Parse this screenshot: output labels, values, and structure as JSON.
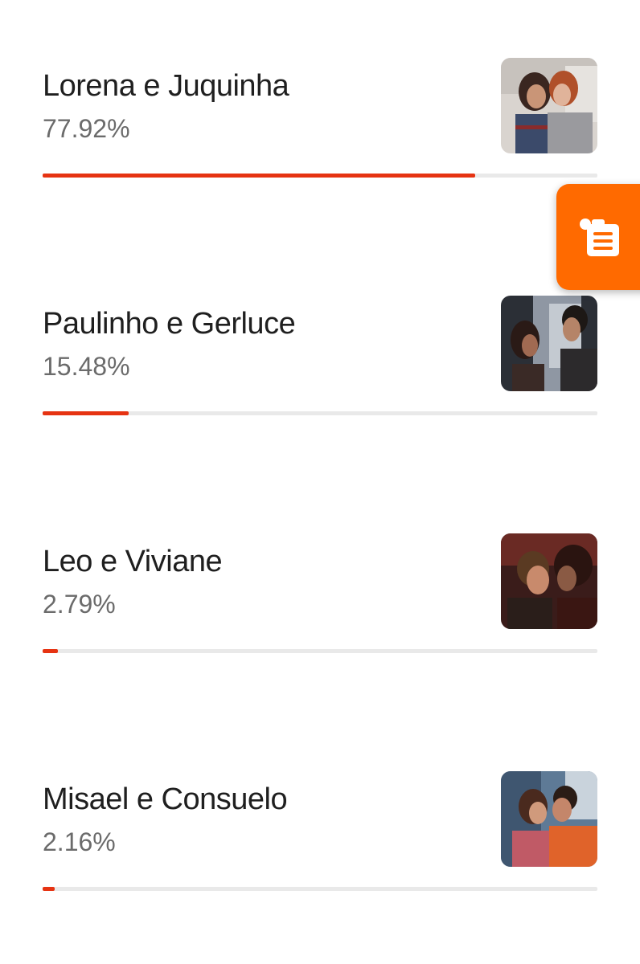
{
  "colors": {
    "accent": "#e63312",
    "fab": "#ff6a00",
    "track": "#e9e9e9"
  },
  "poll": {
    "options": [
      {
        "name": "Lorena e Juquinha",
        "percent": "77.92%",
        "value": 77.92,
        "thumb_icon": "couple-photo-1"
      },
      {
        "name": "Paulinho e Gerluce",
        "percent": "15.48%",
        "value": 15.48,
        "thumb_icon": "couple-photo-2"
      },
      {
        "name": "Leo e Viviane",
        "percent": "2.79%",
        "value": 2.79,
        "thumb_icon": "couple-photo-3"
      },
      {
        "name": "Misael e Consuelo",
        "percent": "2.16%",
        "value": 2.16,
        "thumb_icon": "couple-photo-4"
      }
    ]
  },
  "floating_button": {
    "icon": "clipboard-list-icon"
  }
}
